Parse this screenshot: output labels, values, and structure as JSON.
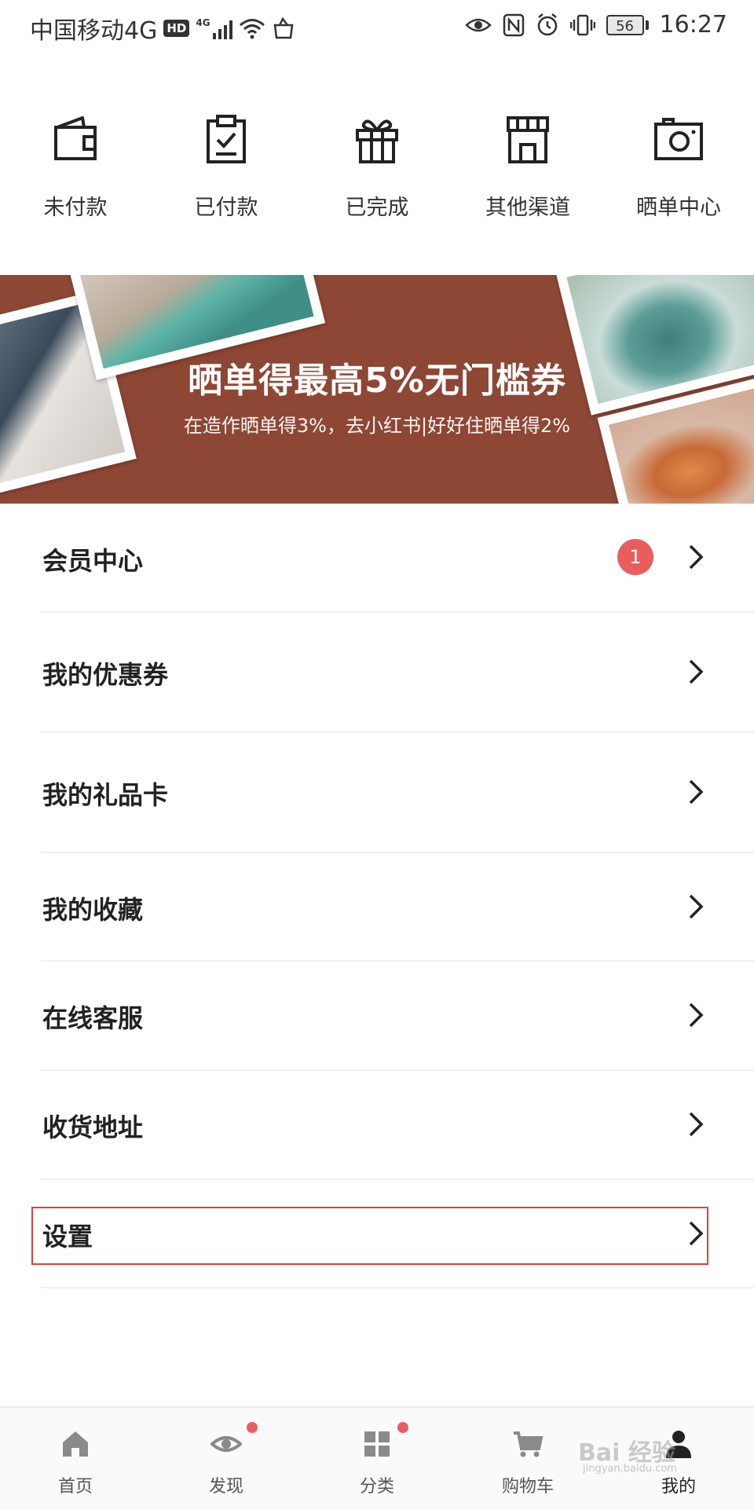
{
  "status_bar": {
    "carrier": "中国移动4G",
    "hd": "HD",
    "net": "4G",
    "battery": "56",
    "time": "16:27"
  },
  "order_row": [
    {
      "label": "未付款",
      "icon": "wallet-icon"
    },
    {
      "label": "已付款",
      "icon": "clipboard-check-icon"
    },
    {
      "label": "已完成",
      "icon": "gift-icon"
    },
    {
      "label": "其他渠道",
      "icon": "storefront-icon"
    },
    {
      "label": "晒单中心",
      "icon": "camera-icon"
    }
  ],
  "banner": {
    "title": "晒单得最高5%无门槛券",
    "subtitle": "在造作晒单得3%，去小红书|好好住晒单得2%"
  },
  "menu": [
    {
      "label": "会员中心",
      "badge": "1"
    },
    {
      "label": "我的优惠券"
    },
    {
      "label": "我的礼品卡"
    },
    {
      "label": "我的收藏"
    },
    {
      "label": "在线客服"
    },
    {
      "label": "收货地址"
    },
    {
      "label": "设置"
    }
  ],
  "tabbar": [
    {
      "label": "首页",
      "icon": "home-icon",
      "dot": false
    },
    {
      "label": "发现",
      "icon": "eye-icon",
      "dot": true
    },
    {
      "label": "分类",
      "icon": "grid-icon",
      "dot": true
    },
    {
      "label": "购物车",
      "icon": "cart-icon",
      "dot": false
    },
    {
      "label": "我的",
      "icon": "profile-icon",
      "dot": false,
      "active": true
    }
  ],
  "watermark": {
    "text": "Bai 经验",
    "sub": "jingyan.baidu.com"
  },
  "colors": {
    "banner_bg": "#8e4735",
    "badge": "#e85e5e",
    "highlight_border": "#e0403e"
  }
}
